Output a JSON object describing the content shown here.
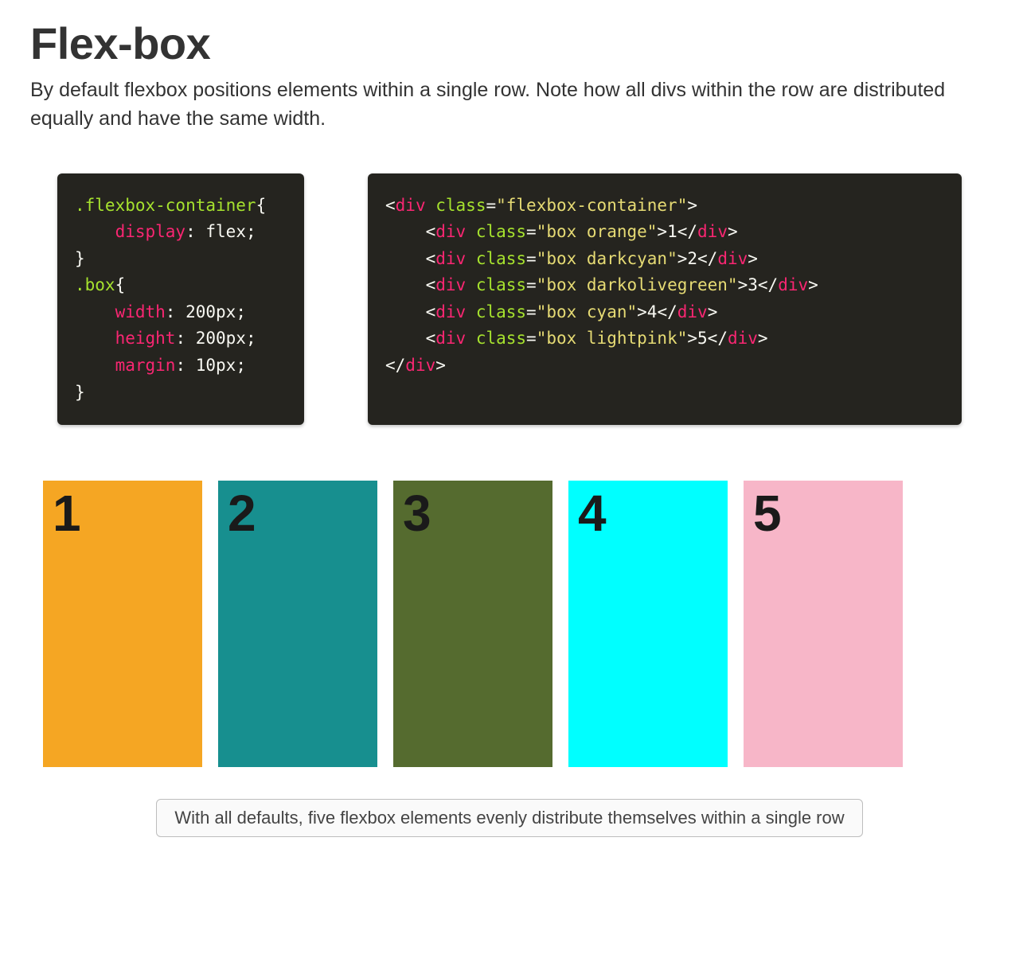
{
  "title": "Flex-box",
  "description": "By default flexbox positions elements within a single row. Note how all divs within the row are distributed equally and have the same width.",
  "css_code": {
    "sel1": ".flexbox-container",
    "prop1": "display",
    "val1": "flex",
    "sel2": ".box",
    "propW": "width",
    "valW": "200px",
    "propH": "height",
    "valH": "200px",
    "propM": "margin",
    "valM": "10px"
  },
  "html_code": {
    "tag_div": "div",
    "attr_class": "class",
    "cls_container": "\"flexbox-container\"",
    "cls1": "\"box orange\"",
    "cls2": "\"box darkcyan\"",
    "cls3": "\"box darkolivegreen\"",
    "cls4": "\"box cyan\"",
    "cls5": "\"box lightpink\"",
    "t1": "1",
    "t2": "2",
    "t3": "3",
    "t4": "4",
    "t5": "5"
  },
  "boxes": {
    "b1": "1",
    "b2": "2",
    "b3": "3",
    "b4": "4",
    "b5": "5"
  },
  "caption": "With all defaults, five flexbox elements evenly distribute themselves within a single row",
  "colors": {
    "orange": "#f5a623",
    "darkcyan": "#178f8f",
    "darkolivegreen": "#556b2f",
    "cyan": "#00ffff",
    "lightpink": "#f7b6c8"
  }
}
